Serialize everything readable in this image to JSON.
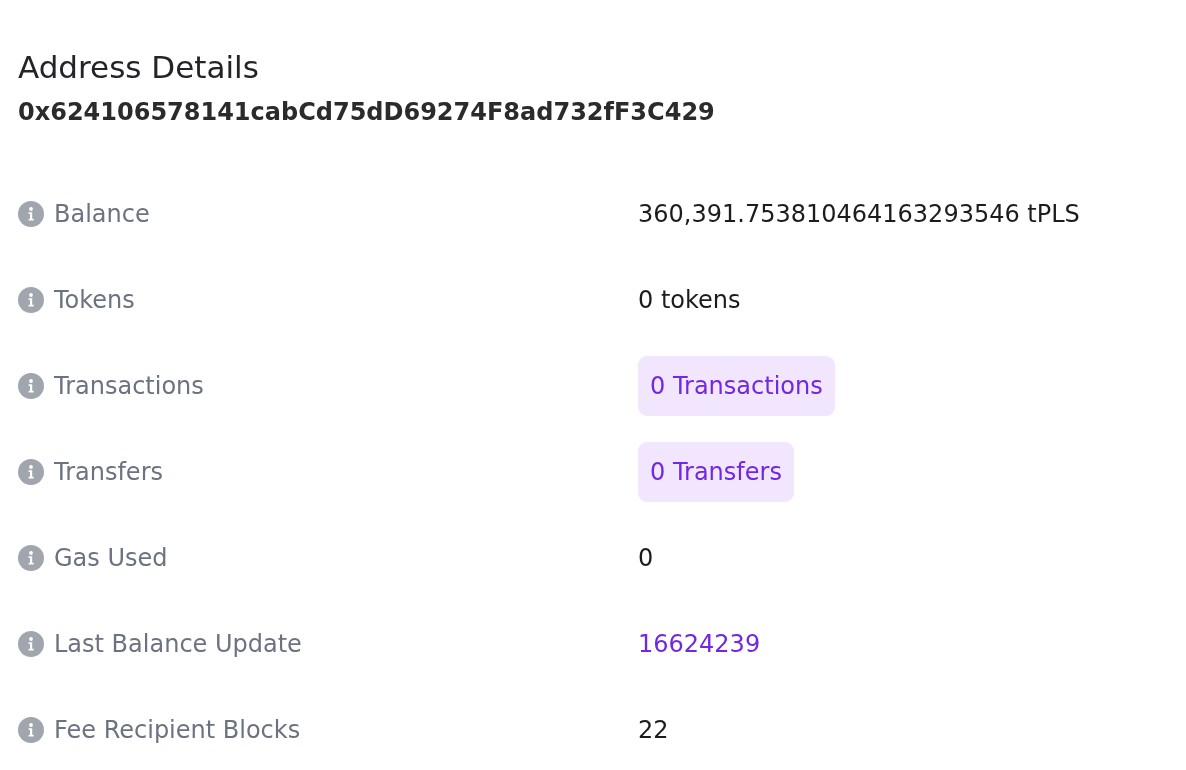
{
  "title": "Address Details",
  "address": "0x624106578141cabCd75dD69274F8ad732fF3C429",
  "rows": [
    {
      "label": "Balance",
      "value": "360,391.753810464163293546 tPLS",
      "kind": "text"
    },
    {
      "label": "Tokens",
      "value": "0 tokens",
      "kind": "text"
    },
    {
      "label": "Transactions",
      "value": "0 Transactions",
      "kind": "badge"
    },
    {
      "label": "Transfers",
      "value": "0 Transfers",
      "kind": "badge"
    },
    {
      "label": "Gas Used",
      "value": "0",
      "kind": "text"
    },
    {
      "label": "Last Balance Update",
      "value": "16624239",
      "kind": "link"
    },
    {
      "label": "Fee Recipient Blocks",
      "value": "22",
      "kind": "text"
    }
  ]
}
